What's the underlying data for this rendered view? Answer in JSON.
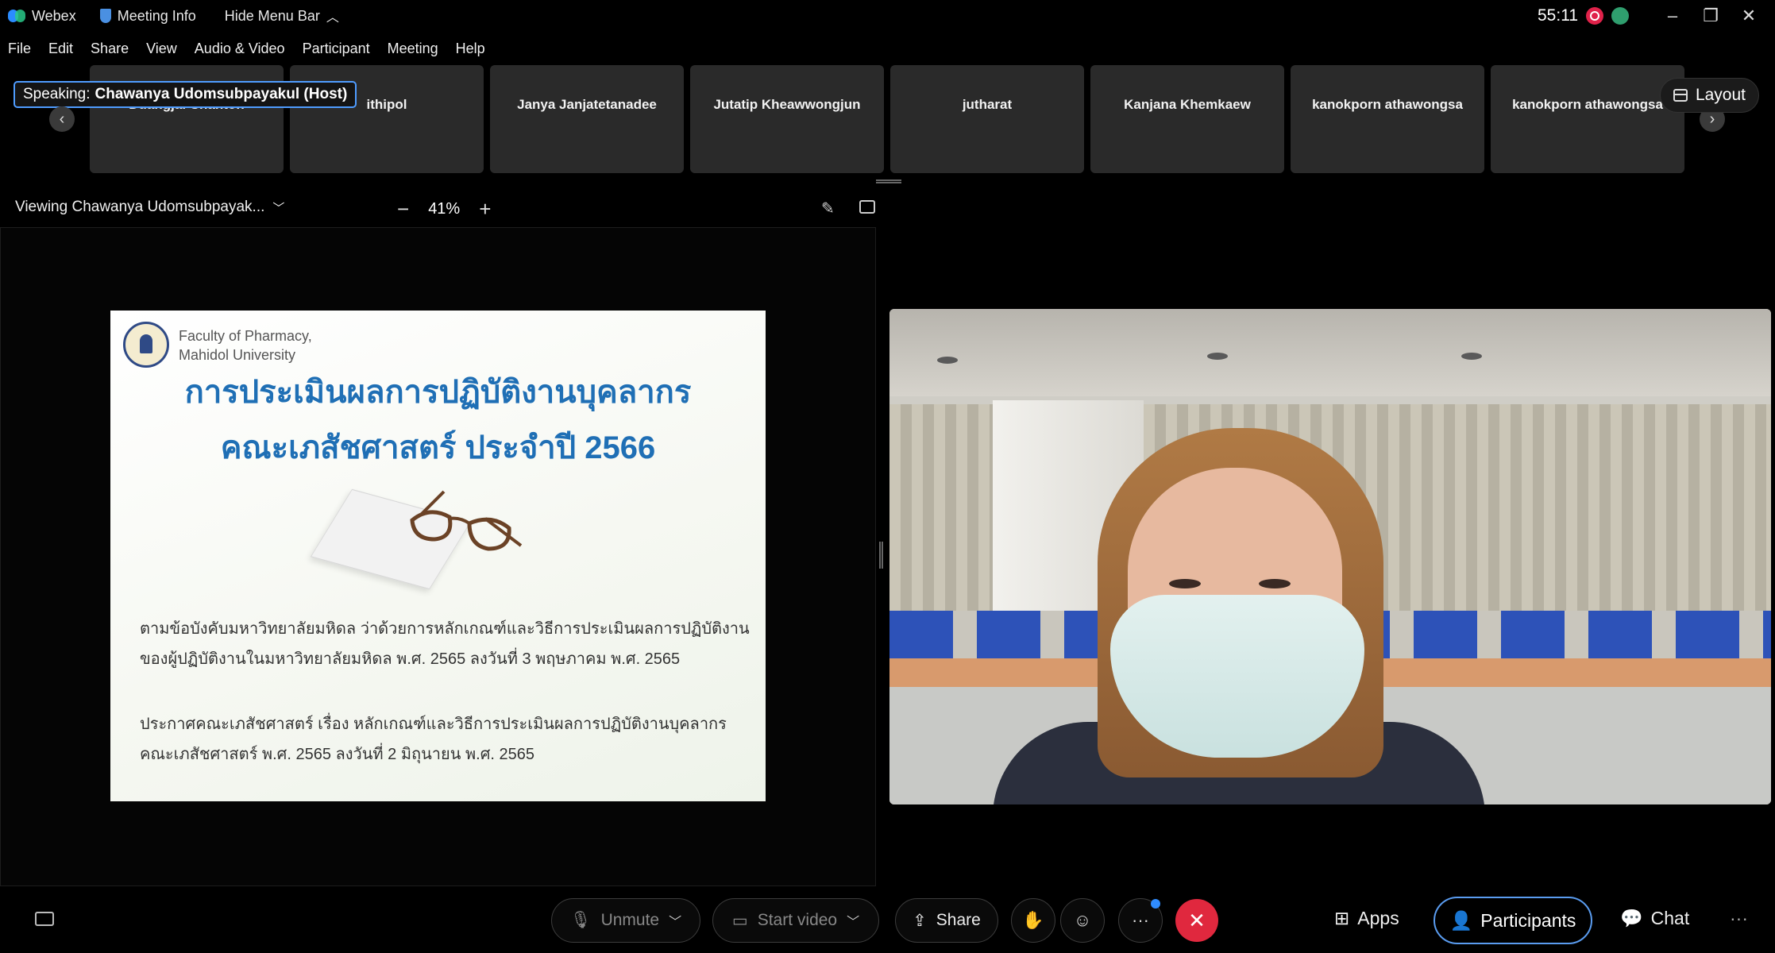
{
  "titlebar": {
    "app_name": "Webex",
    "meeting_info": "Meeting Info",
    "hide_menu": "Hide Menu Bar",
    "timer": "55:11"
  },
  "menu": [
    "File",
    "Edit",
    "Share",
    "View",
    "Audio & Video",
    "Participant",
    "Meeting",
    "Help"
  ],
  "speaking": {
    "prefix": "Speaking:",
    "name": "Chawanya Udomsubpayakul (Host)"
  },
  "layout_label": "Layout",
  "participants": [
    "Duangjai Chanton",
    "ithipol",
    "Janya Janjatetanadee",
    "Jutatip Kheawwongjun",
    "jutharat",
    "Kanjana Khemkaew",
    "kanokporn athawongsa",
    "kanokporn athawongsa"
  ],
  "share_view": {
    "viewing": "Viewing Chawanya Udomsubpayak...",
    "zoom": "41%"
  },
  "slide": {
    "faculty_line1": "Faculty of Pharmacy,",
    "faculty_line2": "Mahidol University",
    "title_line1": "การประเมินผลการปฏิบัติงานบุคลากร",
    "title_line2": "คณะเภสัชศาสตร์ ประจำปี 2566",
    "para1_line1": "ตามข้อบังคับมหาวิทยาลัยมหิดล ว่าด้วยการหลักเกณฑ์และวิธีการประเมินผลการปฏิบัติงาน",
    "para1_line2": "ของผู้ปฏิบัติงานในมหาวิทยาลัยมหิดล พ.ศ. 2565 ลงวันที่ 3 พฤษภาคม พ.ศ. 2565",
    "para2_line1": "ประกาศคณะเภสัชศาสตร์ เรื่อง หลักเกณฑ์และวิธีการประเมินผลการปฏิบัติงานบุคลากร",
    "para2_line2": "คณะเภสัชศาสตร์ พ.ศ. 2565 ลงวันที่ 2 มิถุนายน พ.ศ. 2565"
  },
  "controls": {
    "unmute": "Unmute",
    "start_video": "Start video",
    "share": "Share",
    "apps": "Apps",
    "participants": "Participants",
    "chat": "Chat"
  },
  "colors": {
    "accent": "#5a9cf0",
    "end": "#e0283e",
    "record": "#e0224a"
  }
}
